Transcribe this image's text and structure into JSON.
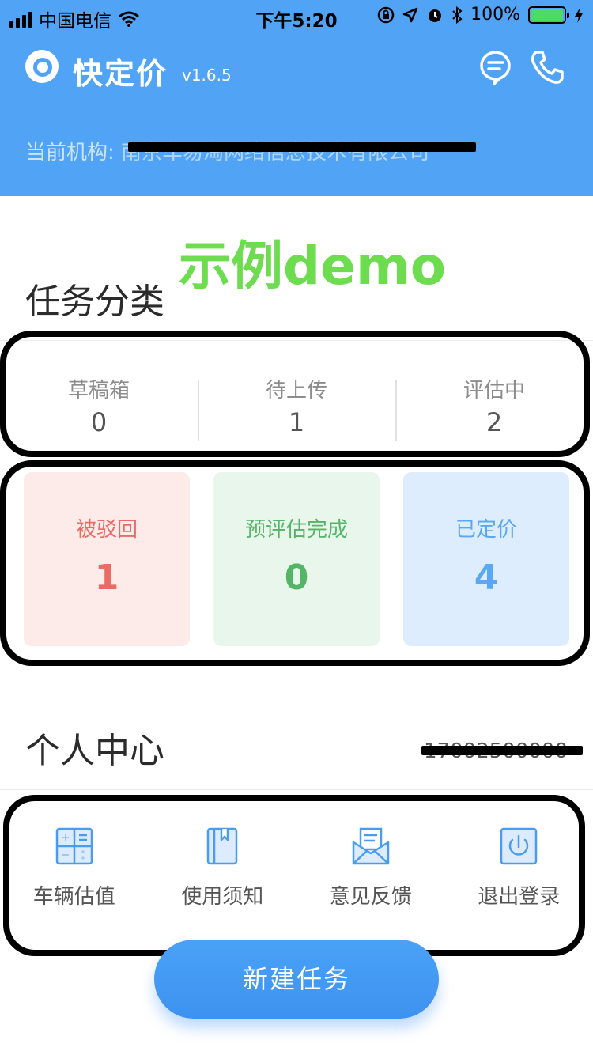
{
  "status_bar": {
    "carrier": "中国电信",
    "time": "下午5:20",
    "battery": "100%"
  },
  "app": {
    "title": "快定价",
    "version": "v1.6.5"
  },
  "org": {
    "label": "当前机构:",
    "value": "南京车易淘网络信息技术有限公司"
  },
  "demo_label": "示例demo",
  "tasks": {
    "title": "任务分类",
    "counts": [
      {
        "label": "草稿箱",
        "value": "0"
      },
      {
        "label": "待上传",
        "value": "1"
      },
      {
        "label": "评估中",
        "value": "2"
      }
    ],
    "cards": [
      {
        "label": "被驳回",
        "value": "1",
        "color": "#ea6a64"
      },
      {
        "label": "预评估完成",
        "value": "0",
        "color": "#55b567"
      },
      {
        "label": "已定价",
        "value": "4",
        "color": "#5aa8f2"
      }
    ]
  },
  "personal": {
    "title": "个人中心",
    "phone": "17002500000",
    "menu": [
      {
        "label": "车辆估值",
        "icon": "calculator-icon"
      },
      {
        "label": "使用须知",
        "icon": "book-icon"
      },
      {
        "label": "意见反馈",
        "icon": "envelope-icon"
      },
      {
        "label": "退出登录",
        "icon": "power-icon"
      }
    ]
  },
  "new_task_label": "新建任务",
  "colors": {
    "header": "#51a3f6",
    "accent": "#3d92ef",
    "demo": "#6ddc4f"
  }
}
